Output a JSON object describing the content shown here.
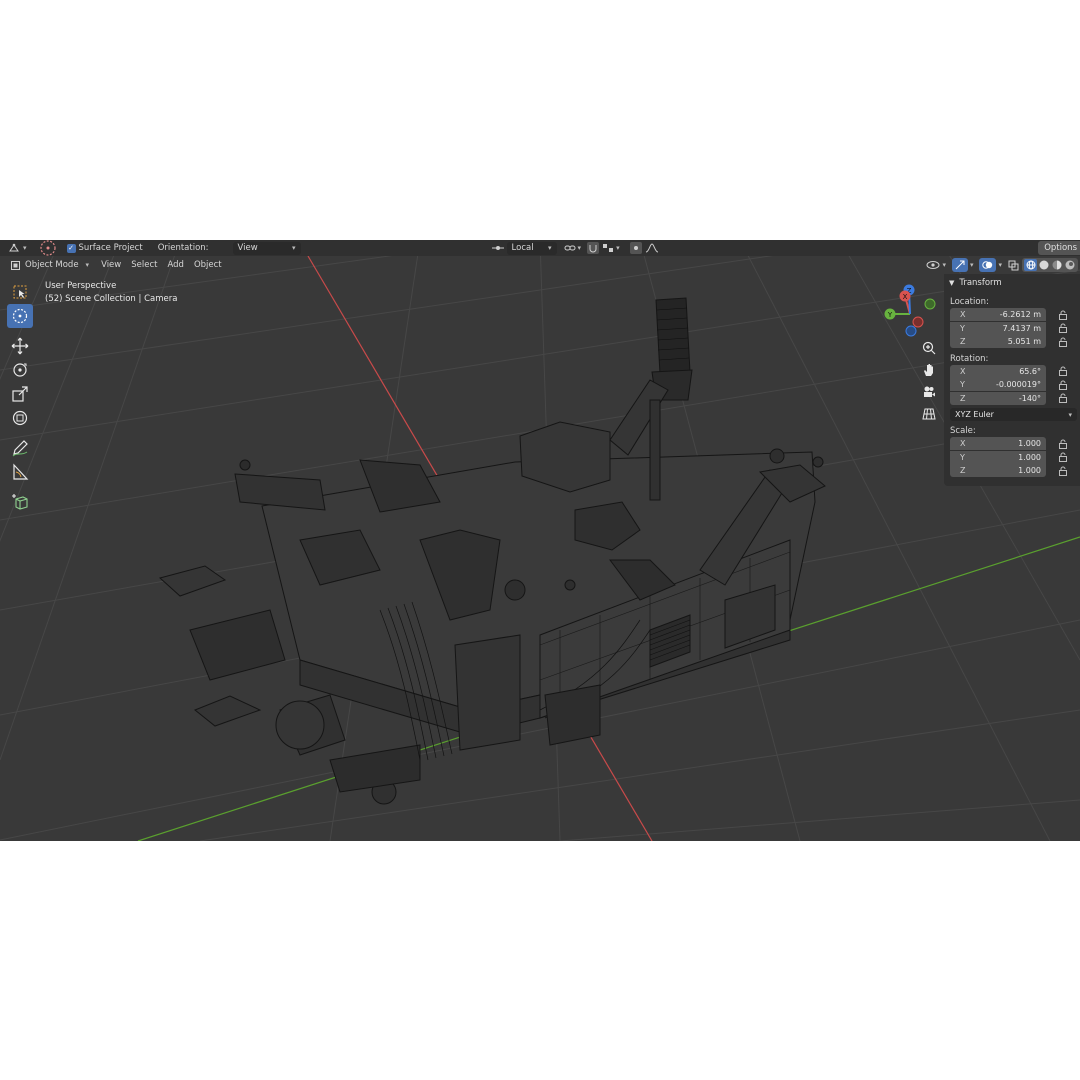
{
  "header": {
    "surface_project_label": "Surface Project",
    "orientation_label": "Orientation:",
    "orientation_value": "View",
    "pivot_value": "Local",
    "options_label": "Options"
  },
  "header2": {
    "mode_label": "Object Mode",
    "menu": [
      "View",
      "Select",
      "Add",
      "Object"
    ]
  },
  "viewport": {
    "perspective_label": "User Perspective",
    "collection_label": "(52) Scene Collection | Camera"
  },
  "gizmo": {
    "x": "X",
    "y": "Y",
    "z": "Z"
  },
  "transform_panel": {
    "title": "Transform",
    "location_label": "Location:",
    "location": [
      {
        "axis": "X",
        "value": "-6.2612 m"
      },
      {
        "axis": "Y",
        "value": "7.4137 m"
      },
      {
        "axis": "Z",
        "value": "5.051 m"
      }
    ],
    "rotation_label": "Rotation:",
    "rotation": [
      {
        "axis": "X",
        "value": "65.6°"
      },
      {
        "axis": "Y",
        "value": "-0.000019°"
      },
      {
        "axis": "Z",
        "value": "-140°"
      }
    ],
    "rotation_mode": "XYZ Euler",
    "scale_label": "Scale:",
    "scale": [
      {
        "axis": "X",
        "value": "1.000"
      },
      {
        "axis": "Y",
        "value": "1.000"
      },
      {
        "axis": "Z",
        "value": "1.000"
      }
    ]
  },
  "colors": {
    "x_axis": "#c84a4a",
    "y_axis": "#5aa02e",
    "accent": "#4772b3",
    "panel": "#303030",
    "viewport_bg": "#393939"
  }
}
